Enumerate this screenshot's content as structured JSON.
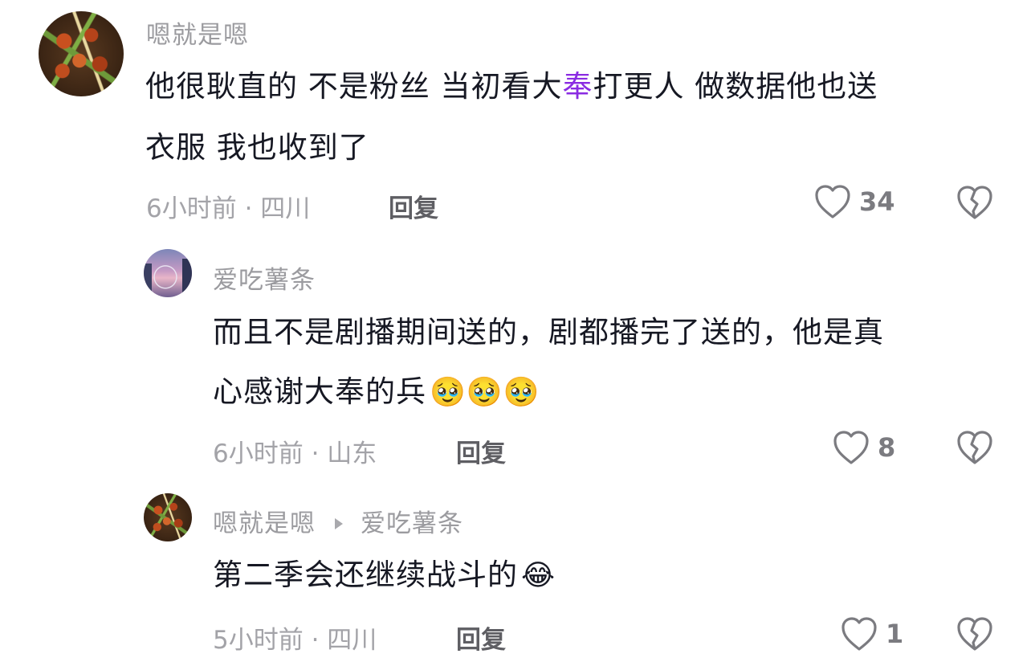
{
  "comments": [
    {
      "username": "嗯就是嗯",
      "text_line1_before": "他很耿直的 不是粉丝 当初看大",
      "text_line1_highlight": "奉",
      "text_line1_after": "打更人 做数据他也送",
      "text_line2": "衣服 我也收到了",
      "meta": "6小时前 · 四川",
      "reply_label": "回复",
      "likes": "34"
    },
    {
      "username": "爱吃薯条",
      "text_line1": "而且不是剧播期间送的，剧都播完了送的，他是真",
      "text_line2": "心感谢大奉的兵",
      "emojis": "🥹🥹🥹",
      "meta": "6小时前 · 山东",
      "reply_label": "回复",
      "likes": "8"
    },
    {
      "username": "嗯就是嗯",
      "reply_to": "爱吃薯条",
      "text_line1": "第二季会还继续战斗的",
      "emojis": "😂",
      "meta": "5小时前 · 四川",
      "reply_label": "回复",
      "likes": "1"
    }
  ],
  "icons": [
    "heart-icon",
    "dislike-icon",
    "reply-arrow-icon"
  ],
  "colors": {
    "text": "#161823",
    "muted": "#a3a3a8",
    "highlight": "#8a2be2"
  }
}
